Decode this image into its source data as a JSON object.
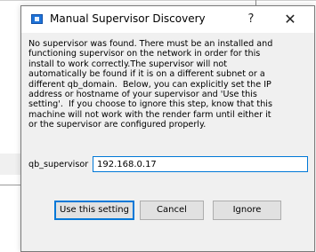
{
  "dialog": {
    "title": "Manual Supervisor Discovery",
    "help_glyph": "?",
    "close_glyph": "✕",
    "message_lines": [
      "No supervisor was found. There must be an installed and",
      "functioning supervisor on the network in order for this",
      "install to work correctly.The supervisor will not",
      "automatically be found if it is on a different subnet or a",
      "different qb_domain.  Below, you can explicitly set the IP",
      "address or hostname of your supervisor and 'Use this",
      "setting'.  If you choose to ignore this step, know that this",
      "machine will not work with the render farm until either it",
      "or the supervisor are configured properly."
    ],
    "field": {
      "label": "qb_supervisor",
      "value": "192.168.0.17"
    },
    "buttons": {
      "use_label": "Use this setting",
      "cancel_label": "Cancel",
      "ignore_label": "Ignore"
    }
  },
  "colors": {
    "accent": "#0078d7",
    "dialog_bg": "#f0f0f0",
    "titlebar_bg": "#ffffff",
    "app_icon": "#1e73d8"
  },
  "icons": {
    "app": "app-window-icon",
    "help": "help-icon",
    "close": "close-icon"
  }
}
